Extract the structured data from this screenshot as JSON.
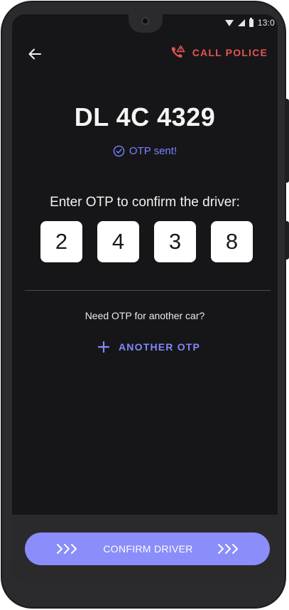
{
  "status_bar": {
    "time": "13:0"
  },
  "header": {
    "back_icon": "arrow-left-icon",
    "call_police_icon": "phone-alert-icon",
    "call_police_label": "CALL POLICE"
  },
  "vehicle": {
    "plate_number": "DL 4C 4329"
  },
  "otp": {
    "sent_icon": "check-circle-icon",
    "sent_text": "OTP sent!",
    "prompt": "Enter OTP to confirm the driver:",
    "digits": [
      "2",
      "4",
      "3",
      "8"
    ]
  },
  "another": {
    "question": "Need OTP for another car?",
    "button_icon": "plus-icon",
    "button_label": "ANOTHER OTP"
  },
  "footer": {
    "confirm_label": "CONFIRM DRIVER",
    "chevron_icon": "triple-chevron-right-icon"
  },
  "colors": {
    "accent": "#8188ff",
    "danger": "#e55353",
    "background": "#161618",
    "button": "#8a8dfa"
  }
}
